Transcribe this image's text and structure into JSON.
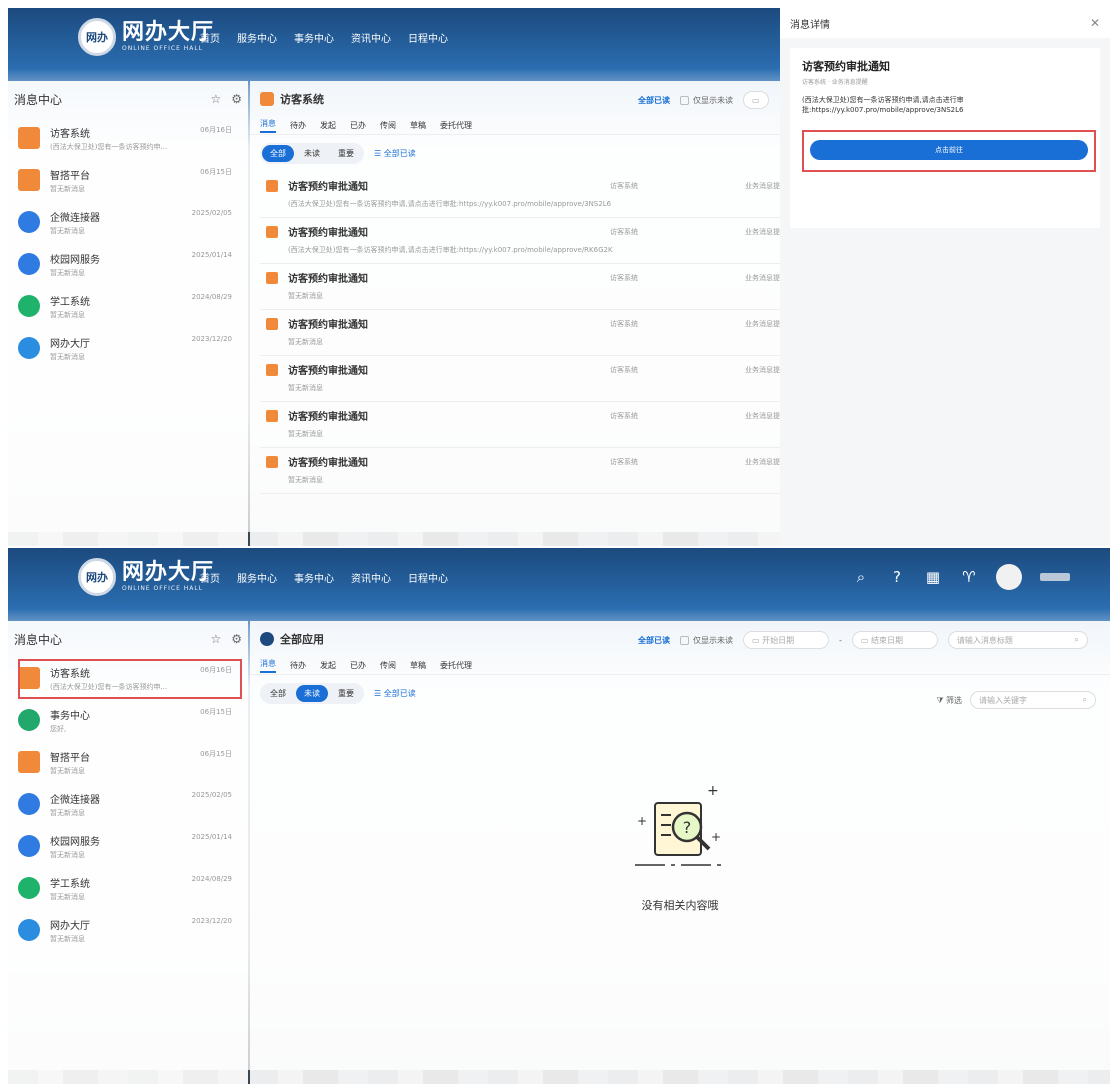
{
  "brand": {
    "main": "网办大厅",
    "sub": "ONLINE OFFICE HALL",
    "badge": "网办"
  },
  "nav": [
    "首页",
    "服务中心",
    "事务中心",
    "资讯中心",
    "日程中心"
  ],
  "sidebar": {
    "title": "消息中心",
    "panelA_items": [
      {
        "title": "访客系统",
        "sub": "(西法大保卫处)您有一条访客预约申...",
        "date": "06月16日",
        "icon": "visitor-icon",
        "color": "#f08a3a"
      },
      {
        "title": "智搭平台",
        "sub": "暂无新消息",
        "date": "06月15日",
        "icon": "platform-icon",
        "color": "#f08a3a"
      },
      {
        "title": "企微连接器",
        "sub": "暂无新消息",
        "date": "2025/02/05",
        "icon": "wecom-icon",
        "color": "#2f7be2"
      },
      {
        "title": "校园网服务",
        "sub": "暂无新消息",
        "date": "2025/01/14",
        "icon": "campus-icon",
        "color": "#2f7be2"
      },
      {
        "title": "学工系统",
        "sub": "暂无新消息",
        "date": "2024/08/29",
        "icon": "student-icon",
        "color": "#1fb26b"
      },
      {
        "title": "网办大厅",
        "sub": "暂无新消息",
        "date": "2023/12/20",
        "icon": "hall-icon",
        "color": "#2a8de0"
      }
    ],
    "panelB_items": [
      {
        "title": "访客系统",
        "sub": "(西法大保卫处)您有一条访客预约申...",
        "date": "06月16日",
        "icon": "visitor-icon",
        "color": "#f08a3a"
      },
      {
        "title": "事务中心",
        "sub": "您好,",
        "date": "06月15日",
        "icon": "affairs-icon",
        "color": "#22a86a"
      },
      {
        "title": "智搭平台",
        "sub": "暂无新消息",
        "date": "06月15日",
        "icon": "platform-icon",
        "color": "#f08a3a"
      },
      {
        "title": "企微连接器",
        "sub": "暂无新消息",
        "date": "2025/02/05",
        "icon": "wecom-icon",
        "color": "#2f7be2"
      },
      {
        "title": "校园网服务",
        "sub": "暂无新消息",
        "date": "2025/01/14",
        "icon": "campus-icon",
        "color": "#2f7be2"
      },
      {
        "title": "学工系统",
        "sub": "暂无新消息",
        "date": "2024/08/29",
        "icon": "student-icon",
        "color": "#1fb26b"
      },
      {
        "title": "网办大厅",
        "sub": "暂无新消息",
        "date": "2023/12/20",
        "icon": "hall-icon",
        "color": "#2a8de0"
      }
    ]
  },
  "panelA": {
    "header_title": "访客系统",
    "mark_all_read": "全部已读",
    "only_unread": "仅显示未读",
    "tabs": [
      "消息",
      "待办",
      "发起",
      "已办",
      "传阅",
      "草稿",
      "委托代理"
    ],
    "filters": [
      "全部",
      "未读",
      "重要"
    ],
    "mark_link": "全部已读",
    "messages": [
      {
        "title": "访客预约审批通知",
        "sub": "(西法大保卫处)您有一条访客预约申请,请点击进行审批:https://yy.k007.pro/mobile/approve/3NS2L6",
        "src": "访客系统",
        "cat": "业务消息提"
      },
      {
        "title": "访客预约审批通知",
        "sub": "(西法大保卫处)您有一条访客预约申请,请点击进行审批:https://yy.k007.pro/mobile/approve/RK6G2K",
        "src": "访客系统",
        "cat": "业务消息提"
      },
      {
        "title": "访客预约审批通知",
        "sub": "暂无新消息",
        "src": "访客系统",
        "cat": "业务消息提"
      },
      {
        "title": "访客预约审批通知",
        "sub": "暂无新消息",
        "src": "访客系统",
        "cat": "业务消息提"
      },
      {
        "title": "访客预约审批通知",
        "sub": "暂无新消息",
        "src": "访客系统",
        "cat": "业务消息提"
      },
      {
        "title": "访客预约审批通知",
        "sub": "暂无新消息",
        "src": "访客系统",
        "cat": "业务消息提"
      },
      {
        "title": "访客预约审批通知",
        "sub": "暂无新消息",
        "src": "访客系统",
        "cat": "业务消息提"
      }
    ],
    "detail": {
      "header": "消息详情",
      "title": "访客预约审批通知",
      "meta": "访客系统 · 业务消息提醒",
      "body": "(西法大保卫处)您有一条访客预约申请,请点击进行审批:https://yy.k007.pro/mobile/approve/3NS2L6",
      "button": "点击前往"
    }
  },
  "panelB": {
    "header_title": "全部应用",
    "mark_all_read": "全部已读",
    "only_unread": "仅显示未读",
    "start_date": "开始日期",
    "end_date": "结束日期",
    "title_placeholder": "请输入消息标题",
    "tabs": [
      "消息",
      "待办",
      "发起",
      "已办",
      "传阅",
      "草稿",
      "委托代理"
    ],
    "filters": [
      "全部",
      "未读",
      "重要"
    ],
    "mark_link": "全部已读",
    "filter_btn": "筛选",
    "keyword_placeholder": "请输入关键字",
    "empty_text": "没有相关内容哦"
  },
  "colors": {
    "primary": "#1a6fd6",
    "nav": "#1c4a7e",
    "highlight": "#e05050"
  }
}
